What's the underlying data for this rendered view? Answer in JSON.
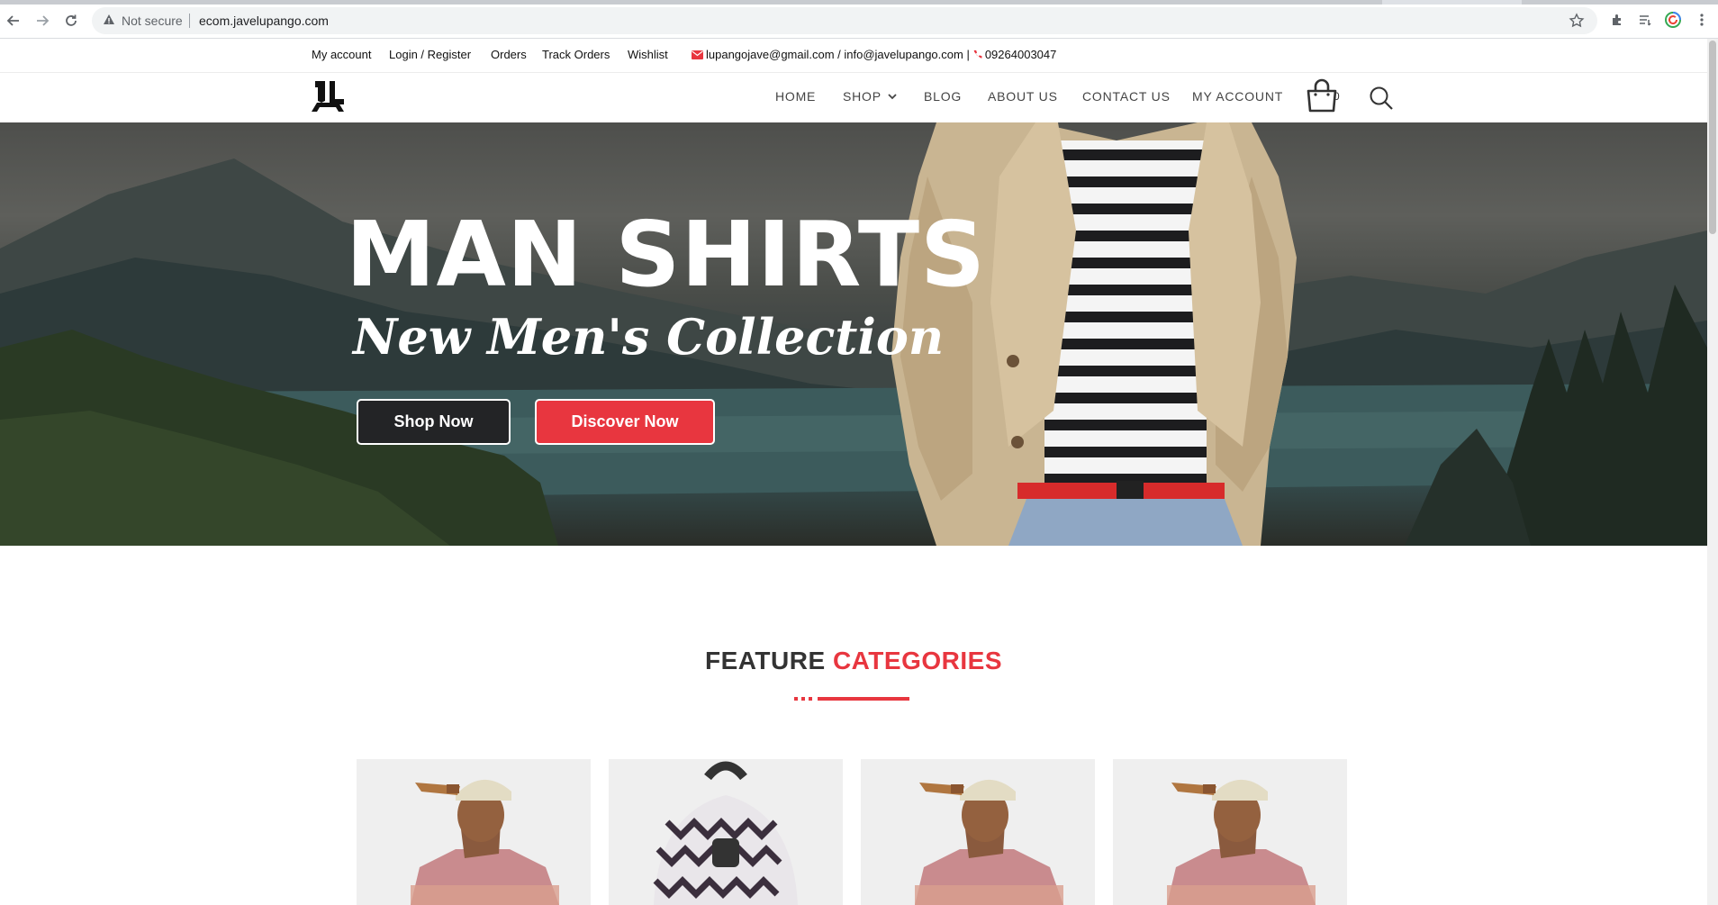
{
  "browser": {
    "security_label": "Not secure",
    "url": "ecom.javelupango.com"
  },
  "topbar": {
    "links": [
      "My account",
      "Login / Register",
      "Orders",
      "Track Orders",
      "Wishlist"
    ],
    "email": "lupangojave@gmail.com / info@javelupango.com |",
    "phone": "09264003047"
  },
  "nav": {
    "items": [
      "HOME",
      "SHOP",
      "BLOG",
      "ABOUT US",
      "CONTACT US",
      "MY ACCOUNT"
    ],
    "cart_count": "0"
  },
  "hero": {
    "title": "MAN SHIRTS",
    "subtitle": "New Men's Collection",
    "shop_button": "Shop Now",
    "discover_button": "Discover Now"
  },
  "feature": {
    "heading_dark": "FEATURE",
    "heading_accent": "CATEGORIES"
  },
  "colors": {
    "accent": "#e8363f",
    "dark": "#232426"
  },
  "categories": [
    {
      "image": "man-with-cap-photo"
    },
    {
      "image": "patterned-backpack-photo"
    },
    {
      "image": "man-with-cap-photo"
    },
    {
      "image": "man-with-cap-photo"
    }
  ]
}
